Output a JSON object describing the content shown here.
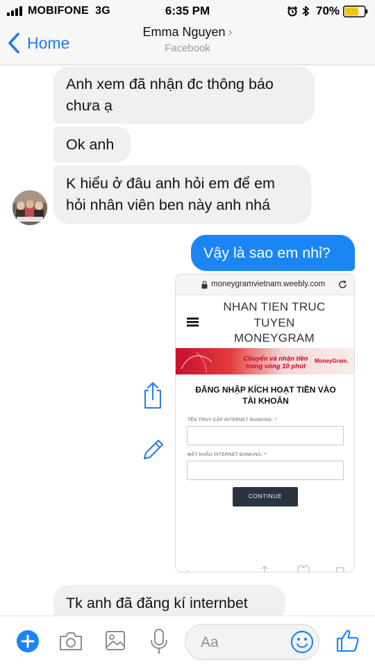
{
  "status_bar": {
    "carrier": "MOBIFONE",
    "network": "3G",
    "time": "6:35 PM",
    "battery_percent": "70%",
    "battery_level": 0.7,
    "icons": [
      "signal-icon",
      "alarm-icon",
      "bluetooth-icon",
      "battery-icon"
    ]
  },
  "nav": {
    "back_label": "Home",
    "contact_name": "Emma Nguyen",
    "chevron": "›",
    "subtitle": "Facebook"
  },
  "messages": [
    {
      "direction": "in",
      "lines": [
        "Anh xem đã nhận đc thông báo",
        "chưa ạ"
      ]
    },
    {
      "direction": "in",
      "lines": [
        "Ok anh"
      ]
    },
    {
      "direction": "in",
      "lines": [
        "K hiểu ở đâu anh hỏi em để em",
        "hỏi nhân viên ben này anh nhá"
      ]
    },
    {
      "direction": "out",
      "lines": [
        "Vậy là sao em nhỉ?"
      ]
    },
    {
      "direction": "in",
      "lines": [
        "Tk anh đã đăng kí internbet"
      ]
    }
  ],
  "shared_screenshot": {
    "url": "moneygramvietnam.weebly.com",
    "site_title_lines": [
      "NHAN TIEN TRUC",
      "TUYEN",
      "MONEYGRAM"
    ],
    "banner_text_lines": [
      "Chuyển và nhận tiền",
      "trong vòng 10 phút"
    ],
    "banner_logo": "MoneyGram.",
    "form_heading_lines": [
      "ĐĂNG NHẬP KÍCH HOẠT TIỀN VÀO",
      "TÀI KHOẢN"
    ],
    "username_label": "TÊN TRUY CẬP INTERNET BANKING: *",
    "password_label": "MẬT KHẨU INTERNET BANKING: *",
    "continue_label": "CONTINUE"
  },
  "composer": {
    "placeholder": "Aa",
    "icons": [
      "plus-icon",
      "camera-icon",
      "image-icon",
      "microphone-icon",
      "emoji-icon",
      "thumbs-up-icon"
    ]
  },
  "colors": {
    "accent": "#1a86f5",
    "incoming_bubble": "#f0f0f0",
    "background": "#ffffff"
  }
}
